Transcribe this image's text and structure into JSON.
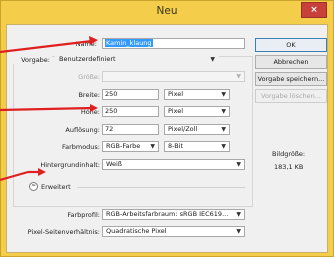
{
  "dialog": {
    "title": "Neu",
    "close_glyph": "×"
  },
  "fields": {
    "name_label": "Name:",
    "name_value": "Kamin_klaung",
    "preset_label": "Vorgabe:",
    "preset_value": "Benutzerdefiniert",
    "size_label": "Größe:",
    "width_label": "Breite:",
    "width_value": "250",
    "width_unit": "Pixel",
    "height_label": "Höhe:",
    "height_value": "250",
    "height_unit": "Pixel",
    "resolution_label": "Auflösung:",
    "resolution_value": "72",
    "resolution_unit": "Pixel/Zoll",
    "colormode_label": "Farbmodus:",
    "colormode_value": "RGB-Farbe",
    "bitdepth_value": "8-Bit",
    "background_label": "Hintergrundinhalt:",
    "background_value": "Weiß"
  },
  "advanced": {
    "toggle_glyph": "≈",
    "label": "Erweitert",
    "profile_label": "Farbprofil:",
    "profile_value": "RGB-Arbeitsfarbraum: sRGB IEC619...",
    "aspect_label": "Pixel-Seitenverhältnis:",
    "aspect_value": "Quadratische Pixel"
  },
  "buttons": {
    "ok": "OK",
    "cancel": "Abbrechen",
    "save_preset": "Vorgabe speichern...",
    "delete_preset": "Vorgabe löschen..."
  },
  "image_size": {
    "label": "Bildgröße:",
    "value": "183,1 KB"
  },
  "colors": {
    "annotation_arrow": "#e02020",
    "title_bar": "#f4ce4a",
    "close_button": "#c7413a"
  },
  "icons": {
    "dropdown": "chevron-down-icon",
    "annotation": "red-arrow-icon"
  }
}
